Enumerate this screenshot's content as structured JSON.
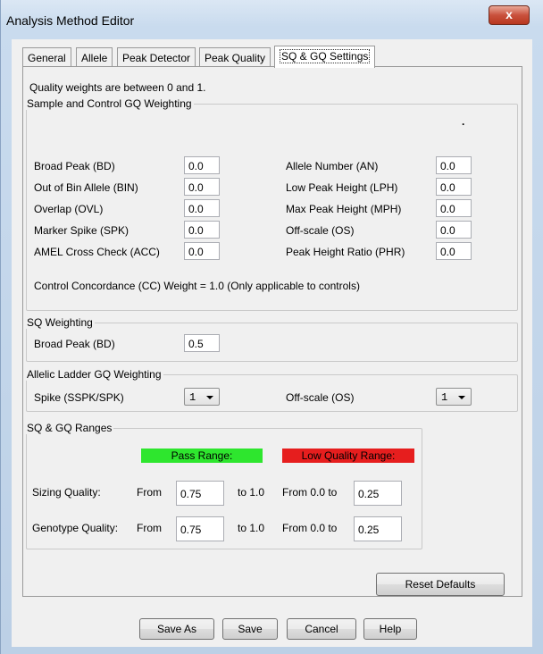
{
  "window": {
    "title": "Analysis Method Editor",
    "close_glyph": "x"
  },
  "tabs": [
    {
      "label": "General"
    },
    {
      "label": "Allele"
    },
    {
      "label": "Peak Detector"
    },
    {
      "label": "Peak Quality"
    },
    {
      "label": "SQ & GQ Settings",
      "active": true
    }
  ],
  "intro": "Quality weights are between 0 and 1.",
  "sample_control": {
    "legend": "Sample and Control GQ Weighting",
    "dot": ".",
    "left": [
      {
        "label": "Broad Peak (BD)",
        "value": "0.0"
      },
      {
        "label": "Out of Bin Allele (BIN)",
        "value": "0.0"
      },
      {
        "label": "Overlap (OVL)",
        "value": "0.0"
      },
      {
        "label": "Marker Spike (SPK)",
        "value": "0.0"
      },
      {
        "label": "AMEL Cross Check (ACC)",
        "value": "0.0"
      }
    ],
    "right": [
      {
        "label": "Allele Number (AN)",
        "value": "0.0"
      },
      {
        "label": "Low Peak Height (LPH)",
        "value": "0.0"
      },
      {
        "label": "Max Peak Height (MPH)",
        "value": "0.0"
      },
      {
        "label": "Off-scale (OS)",
        "value": "0.0"
      },
      {
        "label": "Peak Height Ratio (PHR)",
        "value": "0.0"
      }
    ],
    "note": "Control Concordance (CC) Weight = 1.0 (Only applicable to controls)"
  },
  "sq_weighting": {
    "legend": "SQ Weighting",
    "label": "Broad Peak (BD)",
    "value": "0.5"
  },
  "ladder": {
    "legend": "Allelic Ladder GQ Weighting",
    "spike_label": "Spike (SSPK/SPK)",
    "spike_value": "1",
    "offscale_label": "Off-scale (OS)",
    "offscale_value": "1"
  },
  "ranges": {
    "legend": "SQ & GQ Ranges",
    "pass_header": "Pass Range:",
    "low_header": "Low Quality Range:",
    "pass_color": "#2ee62e",
    "low_color": "#e61e1e",
    "rows": [
      {
        "label": "Sizing Quality:",
        "from": "From",
        "pass_value": "0.75",
        "to": "to 1.0",
        "low_from": "From 0.0 to",
        "low_value": "0.25"
      },
      {
        "label": "Genotype Quality:",
        "from": "From",
        "pass_value": "0.75",
        "to": "to 1.0",
        "low_from": "From 0.0 to",
        "low_value": "0.25"
      }
    ]
  },
  "buttons": {
    "reset": "Reset Defaults",
    "save_as": "Save As",
    "save": "Save",
    "cancel": "Cancel",
    "help": "Help"
  }
}
